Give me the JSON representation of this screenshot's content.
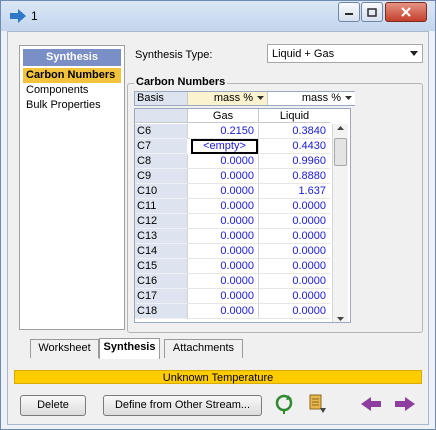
{
  "window": {
    "title": "1"
  },
  "sidebar": {
    "header": "Synthesis",
    "items": [
      {
        "label": "Carbon Numbers",
        "selected": true
      },
      {
        "label": "Components",
        "selected": false
      },
      {
        "label": "Bulk Properties",
        "selected": false
      }
    ]
  },
  "synthesis_type": {
    "label": "Synthesis Type:",
    "value": "Liquid + Gas"
  },
  "carbon_numbers": {
    "group_title": "Carbon Numbers",
    "basis": {
      "label": "Basis",
      "gas": "mass %",
      "liquid": "mass %"
    },
    "columns": [
      "Gas",
      "Liquid"
    ],
    "rows": [
      {
        "name": "C6",
        "gas": "0.2150",
        "liquid": "0.3840"
      },
      {
        "name": "C7",
        "gas": "<empty>",
        "liquid": "0.4430"
      },
      {
        "name": "C8",
        "gas": "0.0000",
        "liquid": "0.9960"
      },
      {
        "name": "C9",
        "gas": "0.0000",
        "liquid": "0.8880"
      },
      {
        "name": "C10",
        "gas": "0.0000",
        "liquid": "1.637"
      },
      {
        "name": "C11",
        "gas": "0.0000",
        "liquid": "0.0000"
      },
      {
        "name": "C12",
        "gas": "0.0000",
        "liquid": "0.0000"
      },
      {
        "name": "C13",
        "gas": "0.0000",
        "liquid": "0.0000"
      },
      {
        "name": "C14",
        "gas": "0.0000",
        "liquid": "0.0000"
      },
      {
        "name": "C15",
        "gas": "0.0000",
        "liquid": "0.0000"
      },
      {
        "name": "C16",
        "gas": "0.0000",
        "liquid": "0.0000"
      },
      {
        "name": "C17",
        "gas": "0.0000",
        "liquid": "0.0000"
      },
      {
        "name": "C18",
        "gas": "0.0000",
        "liquid": "0.0000"
      }
    ]
  },
  "tabs": [
    {
      "label": "Worksheet",
      "active": false
    },
    {
      "label": "Synthesis",
      "active": true
    },
    {
      "label": "Attachments",
      "active": false
    }
  ],
  "status": {
    "text": "Unknown Temperature",
    "color": "#ffcc00"
  },
  "buttons": {
    "delete": "Delete",
    "define_from_stream": "Define from Other Stream..."
  },
  "icons": [
    "arrow-right-icon",
    "minimize-icon",
    "maximize-icon",
    "close-icon",
    "recycle-icon",
    "stream-icon",
    "previous-icon",
    "next-icon"
  ],
  "colors": {
    "accent": "#7a8fc5",
    "selection": "#f3c43b",
    "value_text": "#1a1ad6"
  }
}
